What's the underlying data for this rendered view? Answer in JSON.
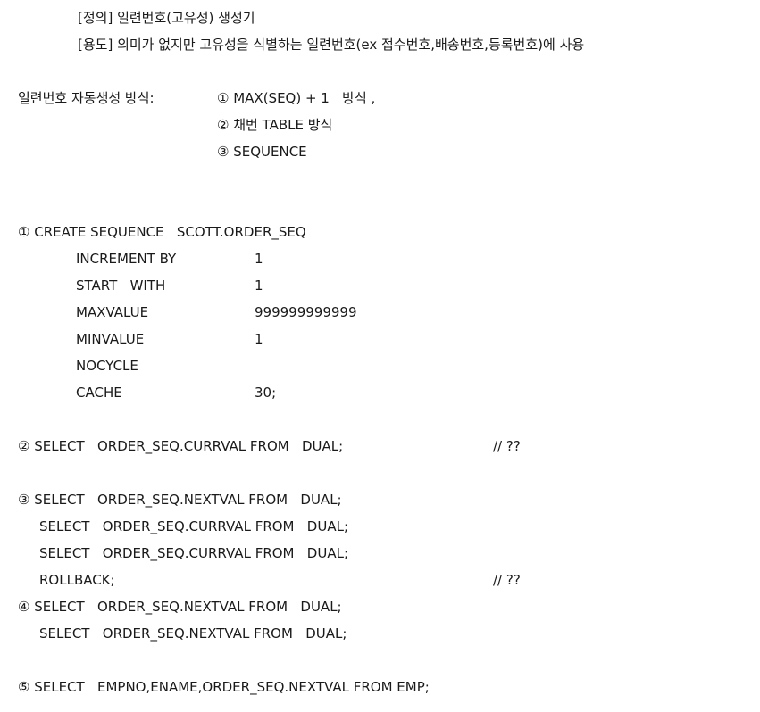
{
  "definition": {
    "def_line": "[정의] 일련번호(고유성) 생성기",
    "usage_line": "[용도] 의미가 없지만 고유성을 식별하는 일련번호(ex 접수번호,배송번호,등록번호)에 사용"
  },
  "methods": {
    "label": "일련번호 자동생성 방식:",
    "items": [
      "① MAX(SEQ) + 1   방식 ,",
      "② 채번 TABLE 방식",
      "③ SEQUENCE"
    ]
  },
  "create": {
    "header": "① CREATE SEQUENCE   SCOTT.ORDER_SEQ",
    "options": [
      {
        "key": "INCREMENT BY",
        "value": "1"
      },
      {
        "key": "START   WITH",
        "value": "1"
      },
      {
        "key": "MAXVALUE",
        "value": "999999999999"
      },
      {
        "key": "MINVALUE",
        "value": "1"
      },
      {
        "key": "NOCYCLE",
        "value": ""
      },
      {
        "key": "CACHE",
        "value": "30;"
      }
    ]
  },
  "statements": {
    "s2": "② SELECT   ORDER_SEQ.CURRVAL FROM   DUAL;",
    "s2_comment": "// ??",
    "s3a": "③ SELECT   ORDER_SEQ.NEXTVAL FROM   DUAL;",
    "s3b": "SELECT   ORDER_SEQ.CURRVAL FROM   DUAL;",
    "s3c": "SELECT   ORDER_SEQ.CURRVAL FROM   DUAL;",
    "s3d": "ROLLBACK;",
    "s3d_comment": "// ??",
    "s4a": "④ SELECT   ORDER_SEQ.NEXTVAL FROM   DUAL;",
    "s4b": "SELECT   ORDER_SEQ.NEXTVAL FROM   DUAL;",
    "s5": "⑤ SELECT   EMPNO,ENAME,ORDER_SEQ.NEXTVAL FROM EMP;"
  }
}
